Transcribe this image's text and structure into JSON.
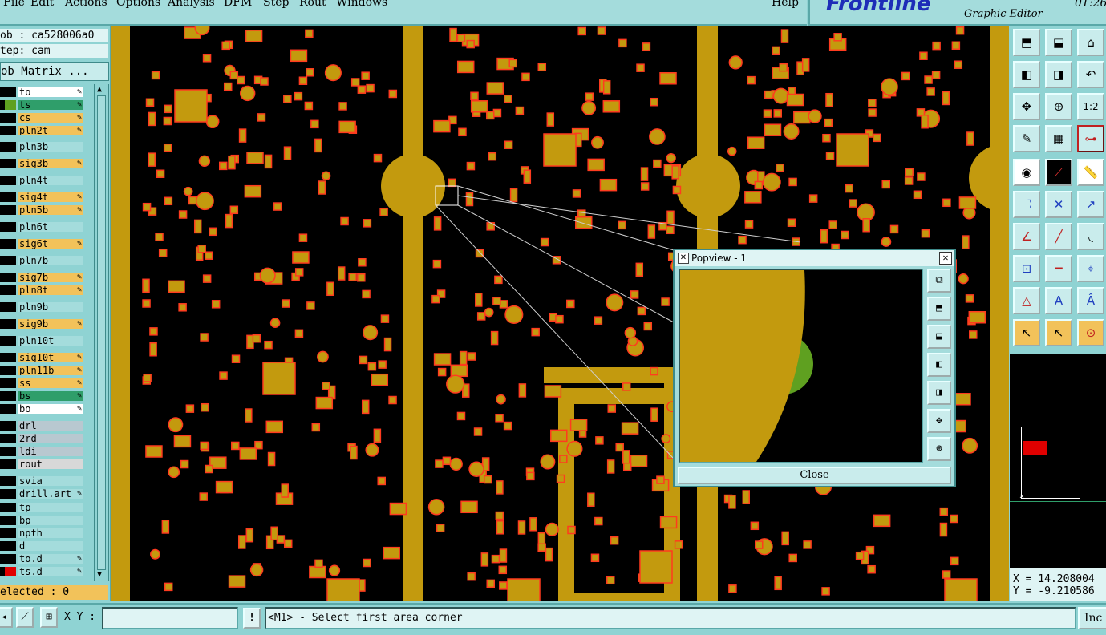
{
  "menubar": {
    "items": [
      "File",
      "Edit",
      "Actions",
      "Options",
      "Analysis",
      "DFM",
      "Step",
      "Rout",
      "Windows"
    ],
    "help": "Help"
  },
  "brand": {
    "logo": "Frontline",
    "subtitle": "Graphic Editor",
    "time": "01:26"
  },
  "job": {
    "job_line": "ob : ca528006a0",
    "step_line": "tep: cam",
    "matrix_button": "ob Matrix ..."
  },
  "layers": [
    {
      "name": "to",
      "color": "#ffffff",
      "editable": true
    },
    {
      "name": "ts",
      "color": "#2f9e6a",
      "editable": true,
      "mark": "#5fa020"
    },
    {
      "name": "cs",
      "color": "#f2c25a",
      "editable": true
    },
    {
      "name": "pln2t",
      "color": "#f2c25a",
      "editable": true
    },
    {
      "name": "pln3b",
      "color": "#a4dcdc",
      "editable": false
    },
    {
      "name": "sig3b",
      "color": "#f2c25a",
      "editable": true
    },
    {
      "name": "pln4t",
      "color": "#a4dcdc",
      "editable": false
    },
    {
      "name": "sig4t",
      "color": "#f2c25a",
      "editable": true
    },
    {
      "name": "pln5b",
      "color": "#f2c25a",
      "editable": true
    },
    {
      "name": "pln6t",
      "color": "#a4dcdc",
      "editable": false
    },
    {
      "name": "sig6t",
      "color": "#f2c25a",
      "editable": true
    },
    {
      "name": "pln7b",
      "color": "#a4dcdc",
      "editable": false
    },
    {
      "name": "sig7b",
      "color": "#f2c25a",
      "editable": true
    },
    {
      "name": "pln8t",
      "color": "#f2c25a",
      "editable": true
    },
    {
      "name": "pln9b",
      "color": "#a4dcdc",
      "editable": false
    },
    {
      "name": "sig9b",
      "color": "#f2c25a",
      "editable": true
    },
    {
      "name": "pln10t",
      "color": "#a4dcdc",
      "editable": false
    },
    {
      "name": "sig10t",
      "color": "#f2c25a",
      "editable": true
    },
    {
      "name": "pln11b",
      "color": "#f2c25a",
      "editable": true
    },
    {
      "name": "ss",
      "color": "#f2c25a",
      "editable": true
    },
    {
      "name": "bs",
      "color": "#2f9e6a",
      "editable": true
    },
    {
      "name": "bo",
      "color": "#ffffff",
      "editable": true
    },
    {
      "name": "drl",
      "color": "#b8c8d0",
      "editable": false
    },
    {
      "name": "2rd",
      "color": "#b8c8d0",
      "editable": false
    },
    {
      "name": "ldi",
      "color": "#b8c8d0",
      "editable": false
    },
    {
      "name": "rout",
      "color": "#d8d8d8",
      "editable": false
    },
    {
      "name": "svia",
      "color": "#a4dcdc",
      "editable": false
    },
    {
      "name": "drill.art",
      "color": "#a4dcdc",
      "editable": true
    },
    {
      "name": "tp",
      "color": "#a4dcdc",
      "editable": false
    },
    {
      "name": "bp",
      "color": "#a4dcdc",
      "editable": false
    },
    {
      "name": "npth",
      "color": "#a4dcdc",
      "editable": false
    },
    {
      "name": "d",
      "color": "#a4dcdc",
      "editable": false
    },
    {
      "name": "to.d",
      "color": "#a4dcdc",
      "editable": true
    },
    {
      "name": "ts.d",
      "color": "#a4dcdc",
      "editable": true,
      "mark": "#e00000"
    }
  ],
  "selected": "elected : 0",
  "popview": {
    "title": "Popview - 1",
    "close_label": "Close"
  },
  "coords": {
    "x": "X = 14.208004",
    "y": "Y = -9.210586"
  },
  "status": {
    "xy_label": "X Y :",
    "xy_value": "",
    "warn": "!",
    "message": "<M1> - Select first area corner",
    "inc": "Inc"
  },
  "colors": {
    "copper": "#c39a0e",
    "pad_outline": "#ff3b1f",
    "highlight": "#5fa020",
    "panel": "#8fd3d3"
  }
}
